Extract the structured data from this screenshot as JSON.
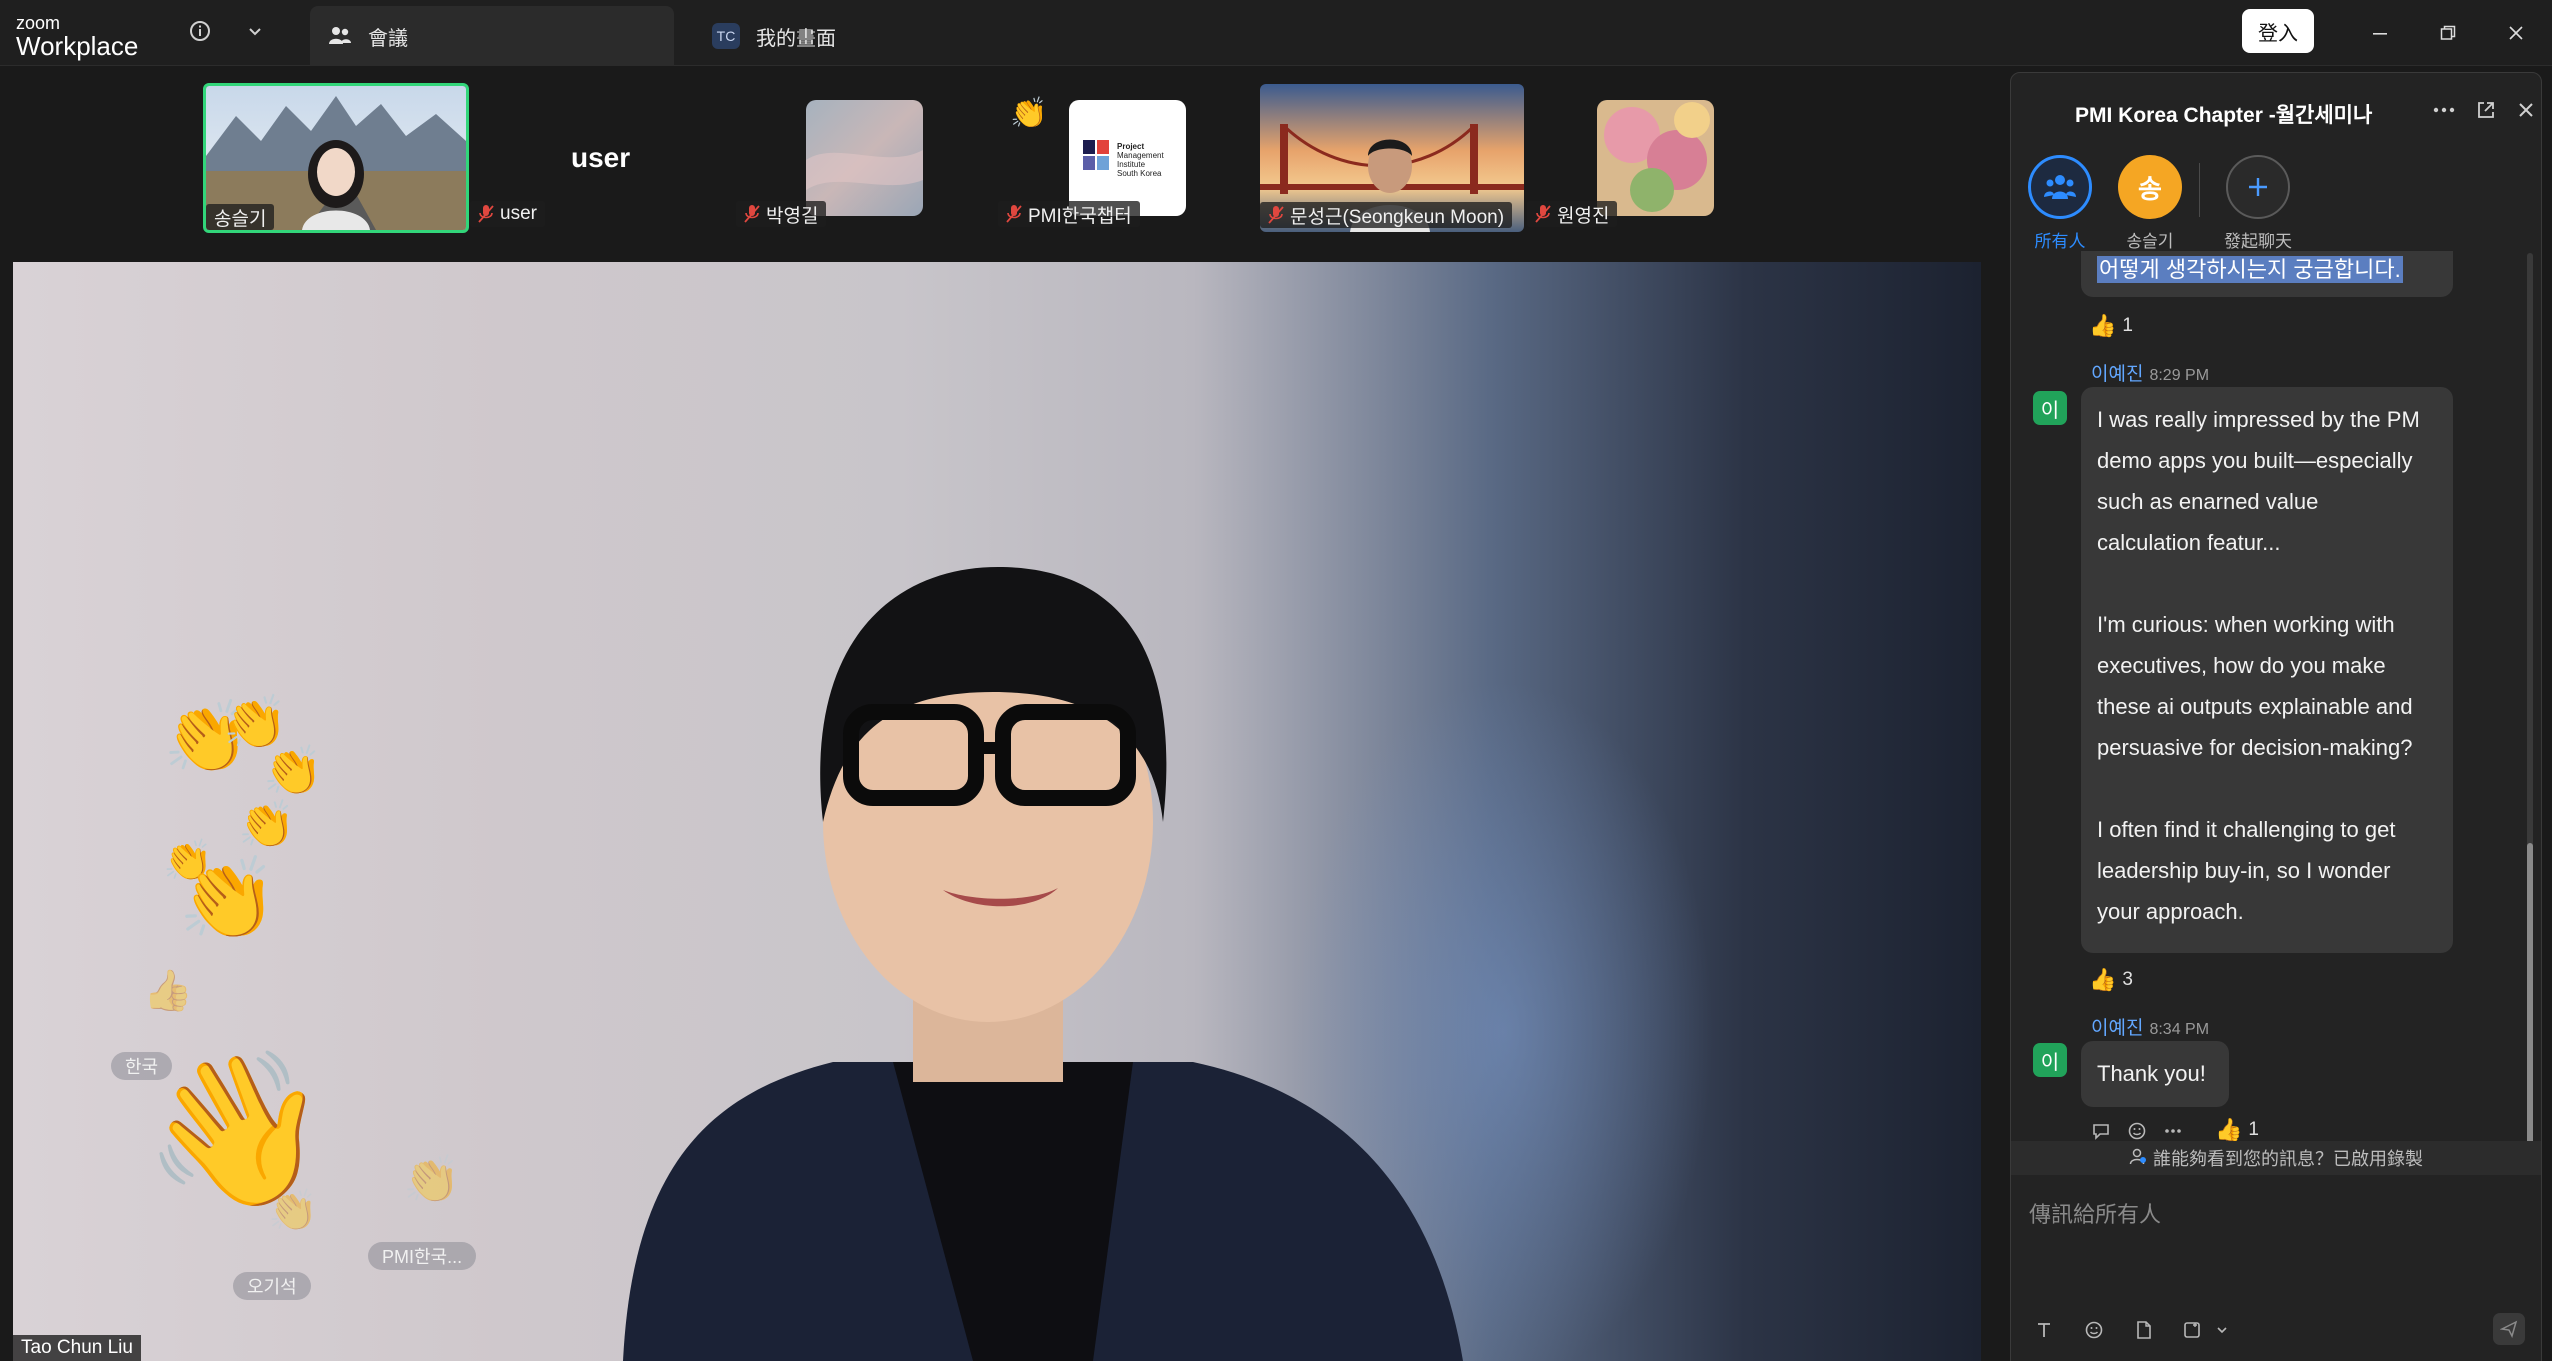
{
  "app": {
    "brand_line1": "zoom",
    "brand_line2": "Workplace"
  },
  "tabs": [
    {
      "label": "會議",
      "icon": "people-icon",
      "active": true
    },
    {
      "label": "我的畫面",
      "badge": "TC",
      "active": false
    }
  ],
  "titlebar": {
    "login_label": "登入"
  },
  "participants": [
    {
      "name": "송슬기",
      "active_speaker": true
    },
    {
      "name": "user",
      "muted": true,
      "display_text": "user"
    },
    {
      "name": "박영길",
      "muted": true
    },
    {
      "name": "PMI한국챕터",
      "muted": true,
      "logo_lines": [
        "Project",
        "Management",
        "Institute",
        "South Korea"
      ]
    },
    {
      "name": "문성근(Seongkeun Moon)",
      "muted": true
    },
    {
      "name": "원영진",
      "muted": true
    }
  ],
  "main_video": {
    "speaker_name": "Tao Chun Liu",
    "floating_labels": [
      "한국",
      "오기석",
      "PMI한국..."
    ]
  },
  "chat": {
    "title": "PMI Korea Chapter -월간세미나",
    "recipients": [
      {
        "label": "所有人",
        "selected": true
      },
      {
        "label": "송슬기",
        "initial": "송",
        "color": "#f5a623"
      },
      {
        "label": "發起聊天"
      }
    ],
    "messages": [
      {
        "highlighted_text": "어떻게 생각하시는지 궁금합니다.",
        "reaction_count": "1"
      },
      {
        "sender": "이예진",
        "avatar": "이",
        "time": "8:29 PM",
        "lines": [
          "I was really impressed by the PM",
          "demo apps you built—especially",
          "such as enarned value",
          "calculation featur...",
          "",
          "I'm curious: when working with",
          "executives, how do you make",
          "these ai  outputs explainable and",
          "persuasive for decision-making?",
          "",
          "I often find it challenging to get",
          "leadership buy-in, so I wonder",
          "your approach."
        ],
        "reaction_count": "3"
      },
      {
        "sender": "이예진",
        "avatar": "이",
        "time": "8:34 PM",
        "text": "Thank you!",
        "reaction_count": "1"
      }
    ],
    "notice": "誰能夠看到您的訊息？已啟用錄製",
    "input_placeholder": "傳訊給所有人"
  },
  "colors": {
    "active_speaker_border": "#32d67a",
    "accent_blue": "#2d8cff",
    "sender_name": "#62a7ff",
    "avatar_green": "#21a35a"
  }
}
